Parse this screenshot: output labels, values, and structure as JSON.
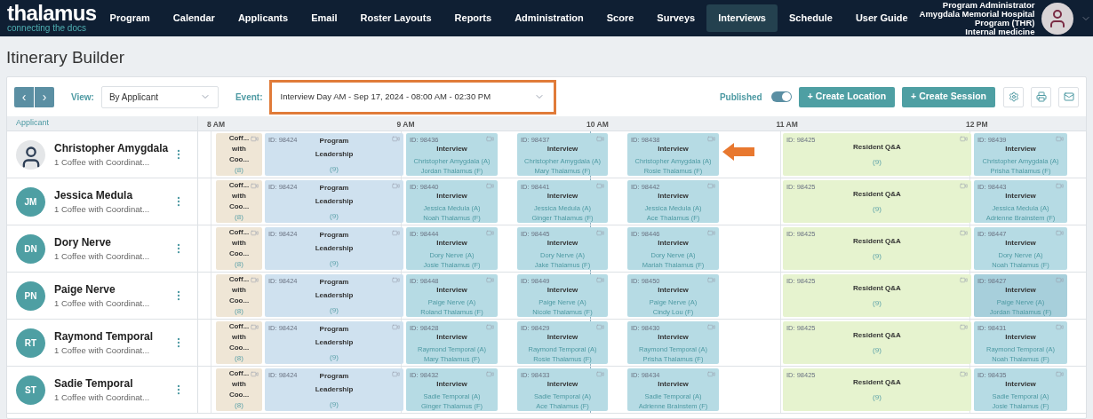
{
  "logo": {
    "name": "thalamus",
    "tagline": "connecting the docs"
  },
  "nav": [
    {
      "label": "Program",
      "selected": false
    },
    {
      "label": "Calendar",
      "selected": false
    },
    {
      "label": "Applicants",
      "selected": false
    },
    {
      "label": "Email",
      "selected": false
    },
    {
      "label": "Roster Layouts",
      "selected": false
    },
    {
      "label": "Reports",
      "selected": false
    },
    {
      "label": "Administration",
      "selected": false
    },
    {
      "label": "Score",
      "selected": false
    },
    {
      "label": "Surveys",
      "selected": false
    },
    {
      "label": "Interviews",
      "selected": true
    },
    {
      "label": "Schedule",
      "selected": false
    },
    {
      "label": "User Guide",
      "selected": false
    }
  ],
  "user": {
    "lines": [
      "Program Administrator",
      "Amygdala Memorial Hospital",
      "Program (THR)",
      "Internal medicine"
    ]
  },
  "page_title": "Itinerary Builder",
  "toolbar": {
    "prev": "‹",
    "next": "›",
    "view_label": "View:",
    "view_value": "By Applicant",
    "event_label": "Event:",
    "event_value": "Interview Day AM - Sep 17, 2024 - 08:00 AM - 02:30 PM",
    "event_highlighted": true,
    "published_label": "Published",
    "published_on": true,
    "buttons": [
      "+ Create Location",
      "+ Create Session"
    ]
  },
  "header": {
    "applicant": "Applicant",
    "hours": [
      "8 AM",
      "9 AM",
      "10 AM",
      "11 AM",
      "12 PM"
    ]
  },
  "rows": [
    {
      "name": "Christopher Amygdala",
      "subtitle": "1 Coffee with Coordinat...",
      "sessions": [
        {
          "kind": "coffee",
          "title": "Coff... with Coo...",
          "count": "(8)"
        },
        {
          "kind": "program",
          "id": "ID: 98424",
          "title": "Program Leadership",
          "count": "(9)"
        },
        {
          "kind": "interview",
          "id": "ID: 98436",
          "title": "Interview",
          "applicant": "Christopher Amygdala (A)",
          "faculty": "Jordan Thalamus (F)"
        },
        {
          "kind": "interview",
          "id": "ID: 98437",
          "title": "Interview",
          "applicant": "Christopher Amygdala (A)",
          "faculty": "Mary Thalamus (F)"
        },
        {
          "kind": "interview",
          "id": "ID: 98438",
          "title": "Interview",
          "applicant": "Christopher Amygdala (A)",
          "faculty": "Rosie Thalamus (F)",
          "pointed": true
        },
        {
          "kind": "resident",
          "id": "ID: 98425",
          "title": "Resident Q&A",
          "count": "(9)"
        },
        {
          "kind": "interview",
          "id": "ID: 98439",
          "title": "Interview",
          "applicant": "Christopher Amygdala (A)",
          "faculty": "Prisha Thalamus (F)"
        }
      ]
    },
    {
      "name": "Jessica Medula",
      "subtitle": "1 Coffee with Coordinat...",
      "initials": "JM",
      "sessions": [
        {
          "kind": "coffee",
          "title": "Coff... with Coo...",
          "count": "(8)"
        },
        {
          "kind": "program",
          "id": "ID: 98424",
          "title": "Program Leadership",
          "count": "(9)"
        },
        {
          "kind": "interview",
          "id": "ID: 98440",
          "title": "Interview",
          "applicant": "Jessica Medula (A)",
          "faculty": "Noah Thalamus (F)"
        },
        {
          "kind": "interview",
          "id": "ID: 98441",
          "title": "Interview",
          "applicant": "Jessica Medula (A)",
          "faculty": "Ginger Thalamus (F)"
        },
        {
          "kind": "interview",
          "id": "ID: 98442",
          "title": "Interview",
          "applicant": "Jessica Medula (A)",
          "faculty": "Ace Thalamus (F)"
        },
        {
          "kind": "resident",
          "id": "ID: 98425",
          "title": "Resident Q&A",
          "count": "(9)"
        },
        {
          "kind": "interview",
          "id": "ID: 98443",
          "title": "Interview",
          "applicant": "Jessica Medula (A)",
          "faculty": "Adrienne Brainstem (F)"
        }
      ]
    },
    {
      "name": "Dory Nerve",
      "subtitle": "1 Coffee with Coordinat...",
      "initials": "DN",
      "sessions": [
        {
          "kind": "coffee",
          "title": "Coff... with Coo...",
          "count": "(8)"
        },
        {
          "kind": "program",
          "id": "ID: 98424",
          "title": "Program Leadership",
          "count": "(9)"
        },
        {
          "kind": "interview",
          "id": "ID: 98444",
          "title": "Interview",
          "applicant": "Dory Nerve (A)",
          "faculty": "Josie Thalamus (F)"
        },
        {
          "kind": "interview",
          "id": "ID: 98445",
          "title": "Interview",
          "applicant": "Dory Nerve (A)",
          "faculty": "Jake Thalamus (F)"
        },
        {
          "kind": "interview",
          "id": "ID: 98446",
          "title": "Interview",
          "applicant": "Dory Nerve (A)",
          "faculty": "Mariah Thalamus (F)"
        },
        {
          "kind": "resident",
          "id": "ID: 98425",
          "title": "Resident Q&A",
          "count": "(9)"
        },
        {
          "kind": "interview",
          "id": "ID: 98447",
          "title": "Interview",
          "applicant": "Dory Nerve (A)",
          "faculty": "Noah Thalamus (F)"
        }
      ]
    },
    {
      "name": "Paige Nerve",
      "subtitle": "1 Coffee with Coordinat...",
      "initials": "PN",
      "sessions": [
        {
          "kind": "coffee",
          "title": "Coff... with Coo...",
          "count": "(8)"
        },
        {
          "kind": "program",
          "id": "ID: 98424",
          "title": "Program Leadership",
          "count": "(9)"
        },
        {
          "kind": "interview",
          "id": "ID: 98448",
          "title": "Interview",
          "applicant": "Paige Nerve (A)",
          "faculty": "Roland Thalamus (F)"
        },
        {
          "kind": "interview",
          "id": "ID: 98449",
          "title": "Interview",
          "applicant": "Paige Nerve (A)",
          "faculty": "Nicole Thalamus (F)"
        },
        {
          "kind": "interview",
          "id": "ID: 98450",
          "title": "Interview",
          "applicant": "Paige Nerve (A)",
          "faculty": "Cindy Lou (F)"
        },
        {
          "kind": "resident",
          "id": "ID: 98425",
          "title": "Resident Q&A",
          "count": "(9)"
        },
        {
          "kind": "interview",
          "id": "ID: 98427",
          "title": "Interview",
          "applicant": "Paige Nerve (A)",
          "faculty": "Jordan Thalamus (F)",
          "selected": true
        }
      ]
    },
    {
      "name": "Raymond Temporal",
      "subtitle": "1 Coffee with Coordinat...",
      "initials": "RT",
      "sessions": [
        {
          "kind": "coffee",
          "title": "Coff... with Coo...",
          "count": "(8)"
        },
        {
          "kind": "program",
          "id": "ID: 98424",
          "title": "Program Leadership",
          "count": "(9)"
        },
        {
          "kind": "interview",
          "id": "ID: 98428",
          "title": "Interview",
          "applicant": "Raymond Temporal (A)",
          "faculty": "Mary Thalamus (F)"
        },
        {
          "kind": "interview",
          "id": "ID: 98429",
          "title": "Interview",
          "applicant": "Raymond Temporal (A)",
          "faculty": "Rosie Thalamus (F)"
        },
        {
          "kind": "interview",
          "id": "ID: 98430",
          "title": "Interview",
          "applicant": "Raymond Temporal (A)",
          "faculty": "Prisha Thalamus (F)"
        },
        {
          "kind": "resident",
          "id": "ID: 98425",
          "title": "Resident Q&A",
          "count": "(9)"
        },
        {
          "kind": "interview",
          "id": "ID: 98431",
          "title": "Interview",
          "applicant": "Raymond Temporal (A)",
          "faculty": "Noah Thalamus (F)"
        }
      ]
    },
    {
      "name": "Sadie Temporal",
      "subtitle": "1 Coffee with Coordinat...",
      "initials": "ST",
      "sessions": [
        {
          "kind": "coffee",
          "title": "Coff... with Coo...",
          "count": "(8)"
        },
        {
          "kind": "program",
          "id": "ID: 98424",
          "title": "Program Leadership",
          "count": "(9)"
        },
        {
          "kind": "interview",
          "id": "ID: 98432",
          "title": "Interview",
          "applicant": "Sadie Temporal (A)",
          "faculty": "Ginger Thalamus (F)"
        },
        {
          "kind": "interview",
          "id": "ID: 98433",
          "title": "Interview",
          "applicant": "Sadie Temporal (A)",
          "faculty": "Ace Thalamus (F)"
        },
        {
          "kind": "interview",
          "id": "ID: 98434",
          "title": "Interview",
          "applicant": "Sadie Temporal (A)",
          "faculty": "Adrienne Brainstem (F)"
        },
        {
          "kind": "resident",
          "id": "ID: 98425",
          "title": "Resident Q&A",
          "count": "(9)"
        },
        {
          "kind": "interview",
          "id": "ID: 98435",
          "title": "Interview",
          "applicant": "Sadie Temporal (A)",
          "faculty": "Josie Thalamus (F)"
        }
      ]
    }
  ]
}
